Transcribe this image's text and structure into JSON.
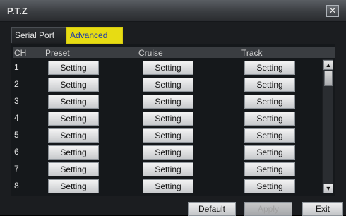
{
  "window": {
    "title": "P.T.Z",
    "close_glyph": "✕"
  },
  "tabs": [
    {
      "label": "Serial Port"
    },
    {
      "label": "Advanced"
    }
  ],
  "table": {
    "columns": [
      "CH",
      "Preset",
      "Cruise",
      "Track"
    ],
    "rows": [
      {
        "ch": "1",
        "preset": "Setting",
        "cruise": "Setting",
        "track": "Setting"
      },
      {
        "ch": "2",
        "preset": "Setting",
        "cruise": "Setting",
        "track": "Setting"
      },
      {
        "ch": "3",
        "preset": "Setting",
        "cruise": "Setting",
        "track": "Setting"
      },
      {
        "ch": "4",
        "preset": "Setting",
        "cruise": "Setting",
        "track": "Setting"
      },
      {
        "ch": "5",
        "preset": "Setting",
        "cruise": "Setting",
        "track": "Setting"
      },
      {
        "ch": "6",
        "preset": "Setting",
        "cruise": "Setting",
        "track": "Setting"
      },
      {
        "ch": "7",
        "preset": "Setting",
        "cruise": "Setting",
        "track": "Setting"
      },
      {
        "ch": "8",
        "preset": "Setting",
        "cruise": "Setting",
        "track": "Setting"
      }
    ]
  },
  "scrollbar": {
    "up_icon": "▲",
    "down_icon": "▼"
  },
  "footer": {
    "default_label": "Default",
    "apply_label": "Apply",
    "exit_label": "Exit"
  }
}
